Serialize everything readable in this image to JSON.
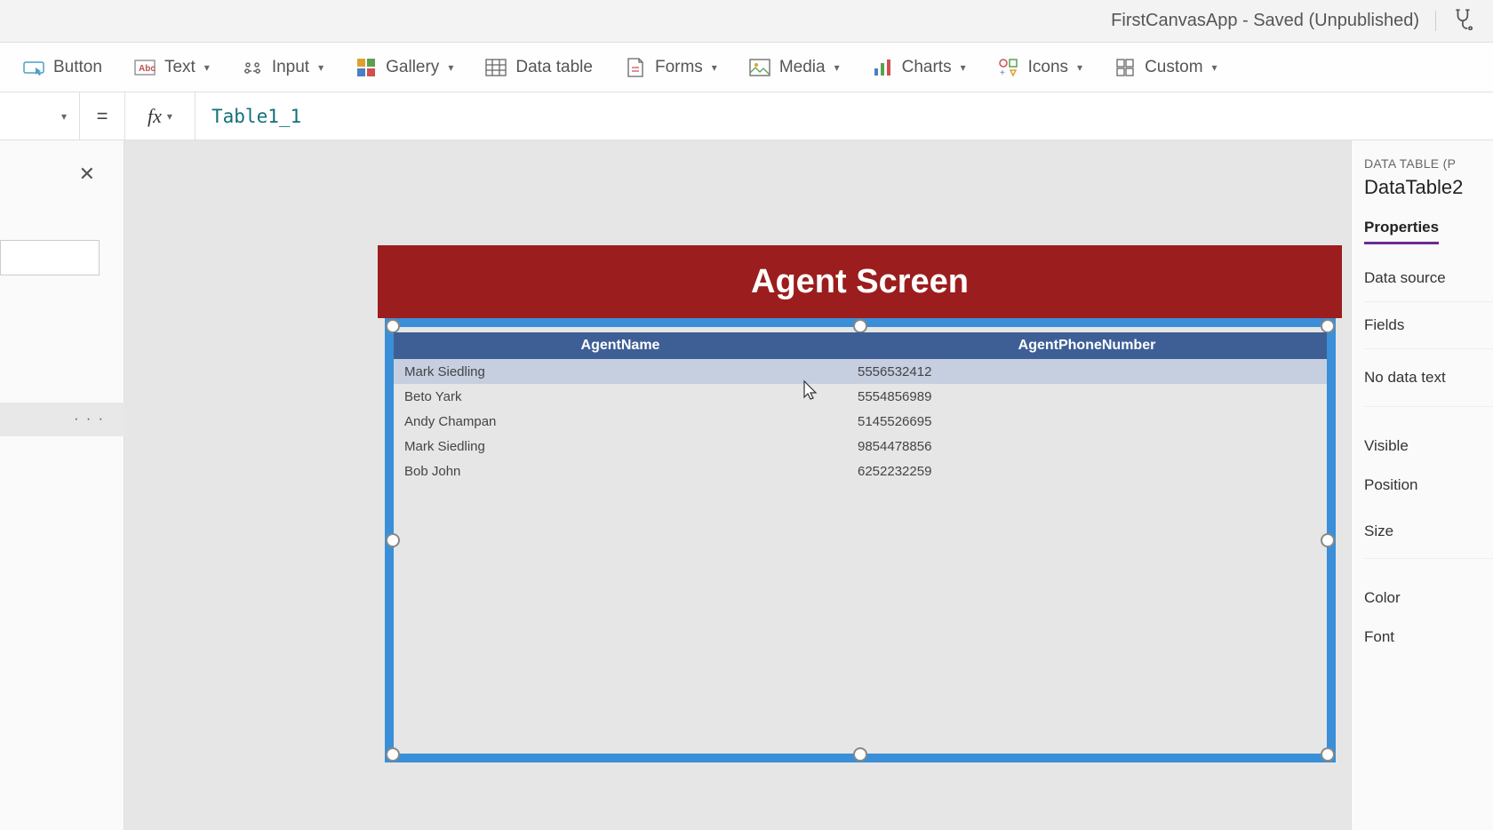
{
  "titlebar": {
    "text": "FirstCanvasApp - Saved (Unpublished)"
  },
  "ribbon": {
    "button": "Button",
    "text": "Text",
    "input": "Input",
    "gallery": "Gallery",
    "datatable": "Data table",
    "forms": "Forms",
    "media": "Media",
    "charts": "Charts",
    "icons": "Icons",
    "custom": "Custom"
  },
  "formulabar": {
    "equals": "=",
    "fx": "fx",
    "value": "Table1_1"
  },
  "leftpanel": {
    "ellipsis": "· · ·"
  },
  "screen": {
    "title": "Agent Screen"
  },
  "table": {
    "headers": [
      "AgentName",
      "AgentPhoneNumber"
    ],
    "rows": [
      {
        "name": "Mark Siedling",
        "phone": "5556532412",
        "selected": true
      },
      {
        "name": "Beto Yark",
        "phone": "5554856989",
        "selected": false
      },
      {
        "name": "Andy Champan",
        "phone": "5145526695",
        "selected": false
      },
      {
        "name": "Mark Siedling",
        "phone": "9854478856",
        "selected": false
      },
      {
        "name": "Bob John",
        "phone": "6252232259",
        "selected": false
      }
    ]
  },
  "rightpanel": {
    "type": "DATA TABLE (P",
    "name": "DataTable2",
    "tab": "Properties",
    "rows": [
      "Data source",
      "Fields",
      "No data text",
      "Visible",
      "Position",
      "Size",
      "Color",
      "Font"
    ]
  }
}
